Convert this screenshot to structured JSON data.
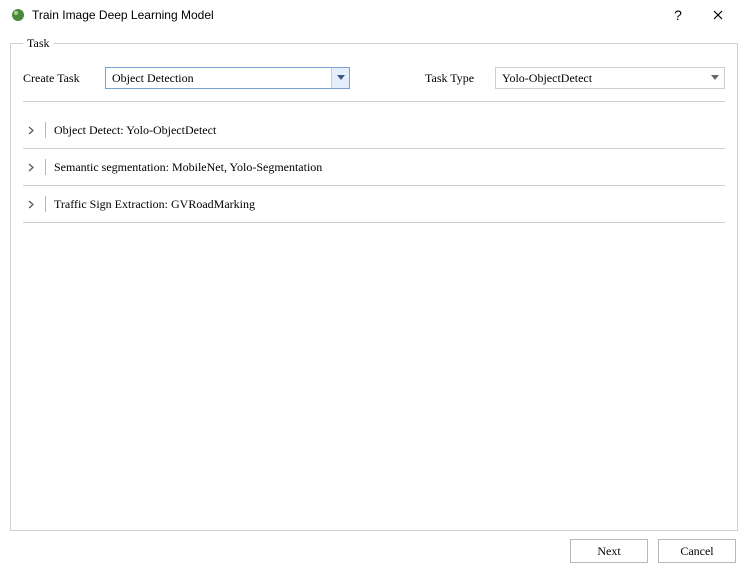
{
  "window": {
    "title": "Train Image Deep Learning Model"
  },
  "task": {
    "legend": "Task",
    "create_label": "Create Task",
    "create_value": "Object Detection",
    "type_label": "Task Type",
    "type_value": "Yolo-ObjectDetect"
  },
  "items": [
    {
      "label": "Object Detect: Yolo-ObjectDetect"
    },
    {
      "label": "Semantic segmentation: MobileNet, Yolo-Segmentation"
    },
    {
      "label": "Traffic Sign Extraction: GVRoadMarking"
    }
  ],
  "buttons": {
    "next": "Next",
    "cancel": "Cancel"
  }
}
